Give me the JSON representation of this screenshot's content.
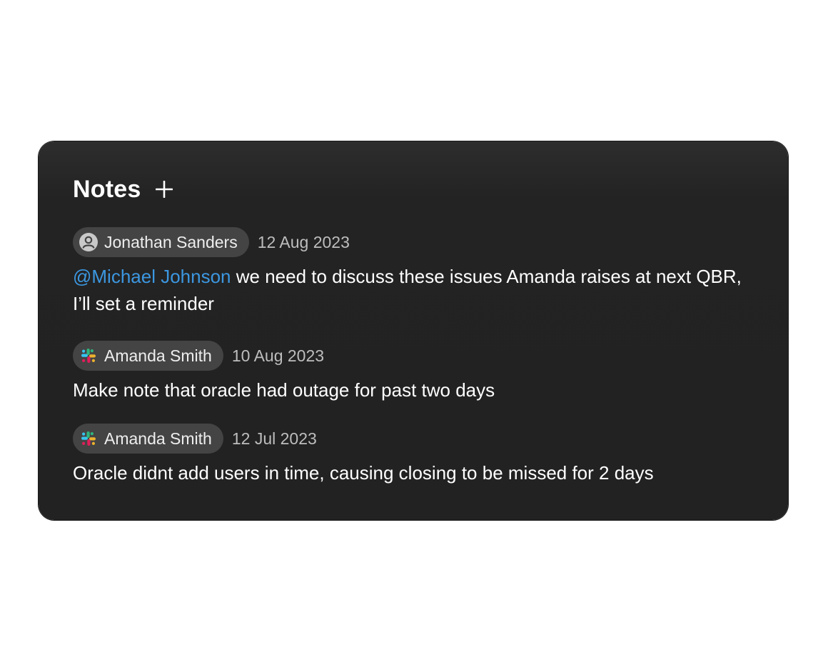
{
  "notes_panel": {
    "title": "Notes",
    "add_icon": "plus-icon",
    "notes": [
      {
        "author": "Jonathan Sanders",
        "author_icon": "person-icon",
        "date": "12 Aug 2023",
        "mention": "@Michael Johnson",
        "text": " we need to discuss these issues Amanda raises at next QBR, I’ll set a reminder"
      },
      {
        "author": "Amanda Smith",
        "author_icon": "slack-icon",
        "date": "10 Aug 2023",
        "text": "Make note that oracle had outage for past two days"
      },
      {
        "author": "Amanda Smith",
        "author_icon": "slack-icon",
        "date": "12 Jul 2023",
        "text": "Oracle didnt add users in time, causing closing to be missed for 2 days"
      }
    ]
  },
  "colors": {
    "card_background": "#222222",
    "chip_background": "#444444",
    "mention": "#3c97e0",
    "date_text": "#bdbdbd"
  }
}
